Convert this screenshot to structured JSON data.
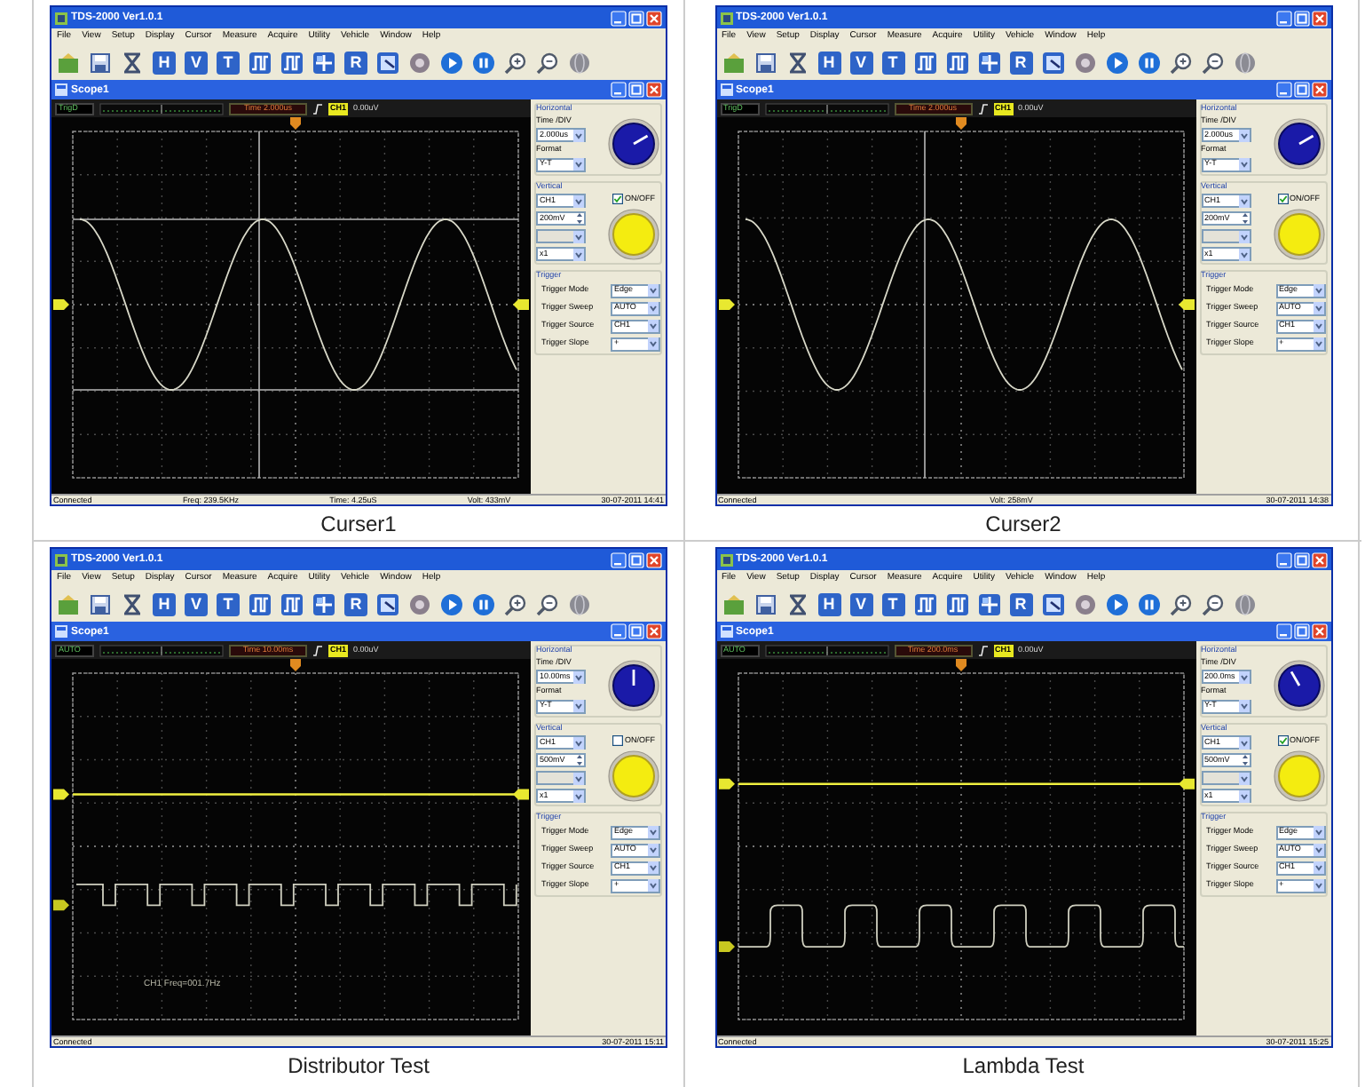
{
  "panels": [
    {
      "caption": "Curser1",
      "window": {
        "title": "TDS-2000 Ver1.0.1",
        "menu": [
          "File",
          "View",
          "Setup",
          "Display",
          "Cursor",
          "Measure",
          "Acquire",
          "Utility",
          "Vehicle",
          "Window",
          "Help"
        ],
        "toolbar_letters": [
          "H",
          "V",
          "T",
          "R"
        ],
        "document_title": "Scope1",
        "mode": "TrigD",
        "time": "Time 2.000us",
        "trigger_channel": "CH1",
        "trigger_level": "0.00uV",
        "traces": [
          {
            "kind": "sine"
          }
        ],
        "cursors": [
          {
            "kind": "vertical"
          },
          {
            "kind": "horizontal"
          }
        ],
        "horizontal": {
          "title": "Horizontal",
          "time_div_label": "Time /DIV",
          "time_div": "2.000us",
          "format_label": "Format",
          "format": "Y-T"
        },
        "vertical": {
          "title": "Vertical",
          "channel": "CH1",
          "onoff_label": "ON/OFF",
          "onoff_checked": true,
          "volts_div": "200mV",
          "offset": {
            "disabled": true
          },
          "probe": "x1"
        },
        "trigger": {
          "title": "Trigger",
          "rows": [
            {
              "label": "Trigger Mode",
              "value": "Edge"
            },
            {
              "label": "Trigger Sweep",
              "value": "AUTO"
            },
            {
              "label": "Trigger Source",
              "value": "CH1"
            },
            {
              "label": "Trigger Slope",
              "value": "+"
            }
          ]
        },
        "status": [
          "Connected",
          "Freq: 239.5KHz",
          "Time: 4.25uS",
          "Volt: 433mV",
          "30-07-2011 14:41"
        ]
      }
    },
    {
      "caption": "Curser2",
      "window": {
        "title": "TDS-2000 Ver1.0.1",
        "menu": [
          "File",
          "View",
          "Setup",
          "Display",
          "Cursor",
          "Measure",
          "Acquire",
          "Utility",
          "Vehicle",
          "Window",
          "Help"
        ],
        "toolbar_letters": [
          "H",
          "V",
          "T",
          "R"
        ],
        "document_title": "Scope1",
        "mode": "TrigD",
        "time": "Time 2.000us",
        "trigger_channel": "CH1",
        "trigger_level": "0.00uV",
        "traces": [
          {
            "kind": "sine"
          }
        ],
        "cursors": [
          {
            "kind": "vertical"
          }
        ],
        "horizontal": {
          "title": "Horizontal",
          "time_div_label": "Time /DIV",
          "time_div": "2.000us",
          "format_label": "Format",
          "format": "Y-T"
        },
        "vertical": {
          "title": "Vertical",
          "channel": "CH1",
          "onoff_label": "ON/OFF",
          "onoff_checked": true,
          "volts_div": "200mV",
          "offset": {
            "disabled": true
          },
          "probe": "x1"
        },
        "trigger": {
          "title": "Trigger",
          "rows": [
            {
              "label": "Trigger Mode",
              "value": "Edge"
            },
            {
              "label": "Trigger Sweep",
              "value": "AUTO"
            },
            {
              "label": "Trigger Source",
              "value": "CH1"
            },
            {
              "label": "Trigger Slope",
              "value": "+"
            }
          ]
        },
        "status": [
          "Connected",
          "Volt: 258mV",
          "30-07-2011 14:38"
        ]
      }
    },
    {
      "caption": "Distributor Test",
      "window": {
        "title": "TDS-2000 Ver1.0.1",
        "menu": [
          "File",
          "View",
          "Setup",
          "Display",
          "Cursor",
          "Measure",
          "Acquire",
          "Utility",
          "Vehicle",
          "Window",
          "Help"
        ],
        "toolbar_letters": [
          "H",
          "V",
          "T",
          "R"
        ],
        "document_title": "Scope1",
        "mode": "AUTO",
        "time": "Time 10.00ms",
        "trigger_channel": "CH1",
        "trigger_level": "0.00uV",
        "traces": [
          {
            "kind": "flat"
          },
          {
            "kind": "square"
          }
        ],
        "annotation": "CH1 Freq=001.7Hz",
        "horizontal": {
          "title": "Horizontal",
          "time_div_label": "Time /DIV",
          "time_div": "10.00ms",
          "format_label": "Format",
          "format": "Y-T"
        },
        "vertical": {
          "title": "Vertical",
          "channel": "CH1",
          "onoff_label": "ON/OFF",
          "onoff_checked": false,
          "volts_div": "500mV",
          "offset": {
            "disabled": true
          },
          "probe": "x1"
        },
        "trigger": {
          "title": "Trigger",
          "rows": [
            {
              "label": "Trigger Mode",
              "value": "Edge"
            },
            {
              "label": "Trigger Sweep",
              "value": "AUTO"
            },
            {
              "label": "Trigger Source",
              "value": "CH1"
            },
            {
              "label": "Trigger Slope",
              "value": "+"
            }
          ]
        },
        "status": [
          "Connected",
          "30-07-2011 15:11"
        ]
      }
    },
    {
      "caption": "Lambda Test",
      "window": {
        "title": "TDS-2000 Ver1.0.1",
        "menu": [
          "File",
          "View",
          "Setup",
          "Display",
          "Cursor",
          "Measure",
          "Acquire",
          "Utility",
          "Vehicle",
          "Window",
          "Help"
        ],
        "toolbar_letters": [
          "H",
          "V",
          "T",
          "R"
        ],
        "document_title": "Scope1",
        "mode": "AUTO",
        "time": "Time 200.0ms",
        "trigger_channel": "CH1",
        "trigger_level": "0.00uV",
        "traces": [
          {
            "kind": "flat"
          },
          {
            "kind": "rounded-square"
          }
        ],
        "horizontal": {
          "title": "Horizontal",
          "time_div_label": "Time /DIV",
          "time_div": "200.0ms",
          "format_label": "Format",
          "format": "Y-T"
        },
        "vertical": {
          "title": "Vertical",
          "channel": "CH1",
          "onoff_label": "ON/OFF",
          "onoff_checked": true,
          "volts_div": "500mV",
          "offset": {
            "disabled": true
          },
          "probe": "x1"
        },
        "trigger": {
          "title": "Trigger",
          "rows": [
            {
              "label": "Trigger Mode",
              "value": "Edge"
            },
            {
              "label": "Trigger Sweep",
              "value": "AUTO"
            },
            {
              "label": "Trigger Source",
              "value": "CH1"
            },
            {
              "label": "Trigger Slope",
              "value": "+"
            }
          ]
        },
        "status": [
          "Connected",
          "30-07-2011 15:25"
        ]
      }
    }
  ]
}
